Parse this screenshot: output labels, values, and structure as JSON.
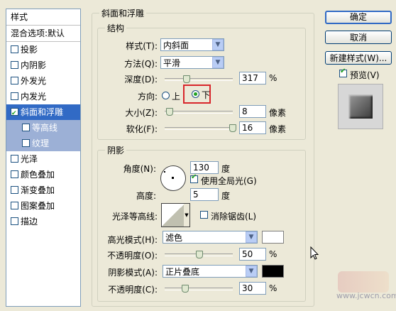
{
  "styles_panel": {
    "header": "样式",
    "blend_options": "混合选项:默认",
    "items": [
      {
        "label": "投影",
        "checked": false
      },
      {
        "label": "内阴影",
        "checked": false
      },
      {
        "label": "外发光",
        "checked": false
      },
      {
        "label": "内发光",
        "checked": false
      },
      {
        "label": "斜面和浮雕",
        "checked": true
      },
      {
        "label": "等高线",
        "checked": false
      },
      {
        "label": "纹理",
        "checked": false
      },
      {
        "label": "光泽",
        "checked": false
      },
      {
        "label": "颜色叠加",
        "checked": false
      },
      {
        "label": "渐变叠加",
        "checked": false
      },
      {
        "label": "图案叠加",
        "checked": false
      },
      {
        "label": "描边",
        "checked": false
      }
    ]
  },
  "bevel": {
    "title": "斜面和浮雕",
    "structure": {
      "title": "结构",
      "style_label": "样式(T):",
      "style_value": "内斜面",
      "technique_label": "方法(Q):",
      "technique_value": "平滑",
      "depth_label": "深度(D):",
      "depth_value": "317",
      "depth_unit": "%",
      "depth_pct": 0.35,
      "direction_label": "方向:",
      "dir_up": "上",
      "dir_down": "下",
      "size_label": "大小(Z):",
      "size_value": "8",
      "size_unit": "像素",
      "size_pct": 0.04,
      "soften_label": "软化(F):",
      "soften_value": "16",
      "soften_unit": "像素",
      "soften_pct": 1.0
    },
    "shading": {
      "title": "阴影",
      "angle_label": "角度(N):",
      "angle_value": "130",
      "angle_unit": "度",
      "use_global_light": "使用全局光(G)",
      "altitude_label": "高度:",
      "altitude_value": "5",
      "altitude_unit": "度",
      "gloss_label": "光泽等高线:",
      "anti_aliased": "消除锯齿(L)",
      "highlight_label": "高光模式(H):",
      "highlight_mode": "滤色",
      "highlight_color": "#ffffff",
      "highlight_opacity_label": "不透明度(O):",
      "highlight_opacity": "50",
      "highlight_pct": 0.5,
      "shadow_label": "阴影模式(A):",
      "shadow_mode": "正片叠底",
      "shadow_color": "#000000",
      "shadow_opacity_label": "不透明度(C):",
      "shadow_opacity": "30",
      "shadow_pct": 0.3,
      "pct_unit": "%"
    }
  },
  "buttons": {
    "ok": "确定",
    "cancel": "取消",
    "new_style": "新建样式(W)...",
    "preview": "预览(V)"
  },
  "watermark": "www.jcwcn.com"
}
